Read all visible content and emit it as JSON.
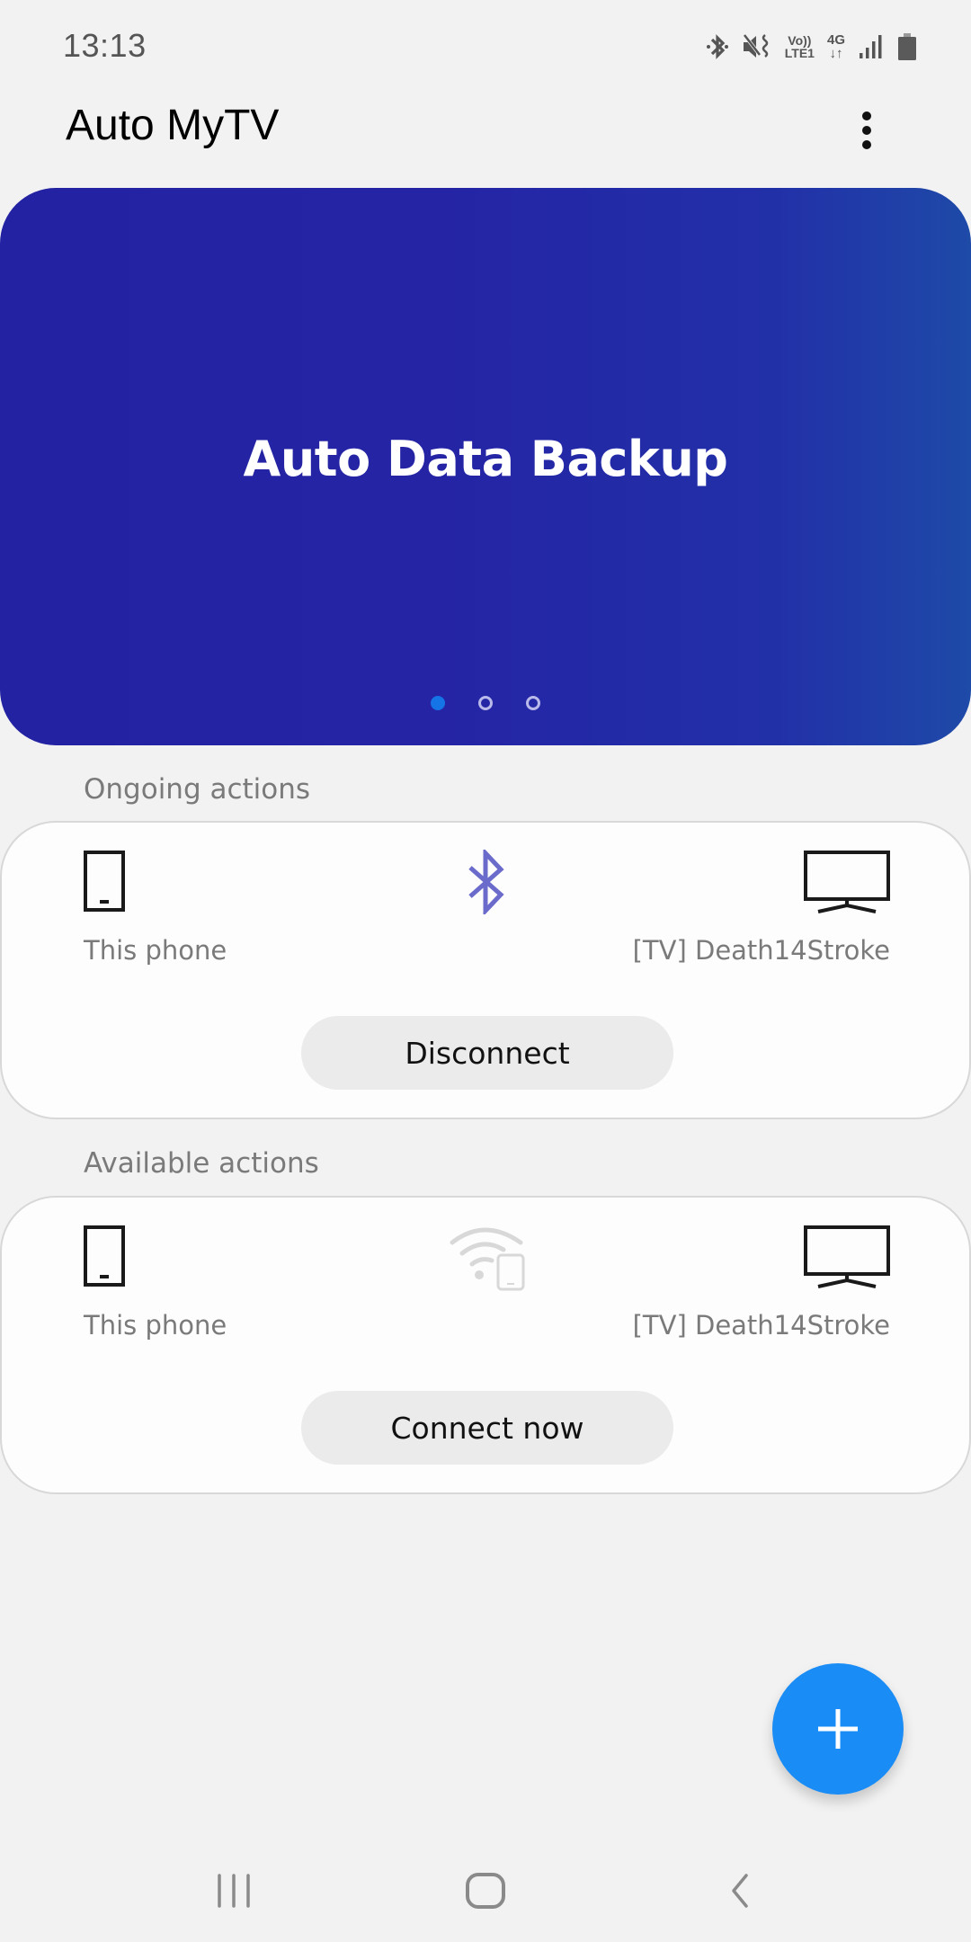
{
  "status_bar": {
    "time": "13:13",
    "icons": [
      "bluetooth-icon",
      "mute-vibrate-icon",
      "volte-icon",
      "4g-data-icon",
      "signal-icon",
      "battery-icon"
    ],
    "volte_top": "Vo))",
    "volte_bottom": "LTE1",
    "network_type": "4G",
    "network_arrows": "↓↑"
  },
  "app_bar": {
    "title": "Auto MyTV",
    "more_icon": "more-vertical-icon"
  },
  "banner": {
    "title": "Auto Data Backup",
    "page_count": 3,
    "active_page": 1,
    "colors": {
      "start": "#2322a2",
      "end": "#1e4aa8",
      "active_dot": "#1574e6"
    }
  },
  "ongoing": {
    "section_label": "Ongoing actions",
    "source_label": "This phone",
    "source_icon": "phone-icon",
    "connection_icon": "bluetooth-icon",
    "connection_color": "#6b6bcc",
    "target_label": "[TV] Death14Stroke",
    "target_icon": "tv-icon",
    "button_label": "Disconnect"
  },
  "available": {
    "section_label": "Available actions",
    "source_label": "This phone",
    "source_icon": "phone-icon",
    "connection_icon": "wifi-phone-icon",
    "connection_color": "#d8d8d8",
    "target_label": "[TV] Death14Stroke",
    "target_icon": "tv-icon",
    "button_label": "Connect now"
  },
  "fab": {
    "icon": "plus-icon",
    "color": "#1a8cf5"
  },
  "nav_bar": {
    "buttons": [
      "recents-icon",
      "home-icon",
      "back-icon"
    ]
  }
}
